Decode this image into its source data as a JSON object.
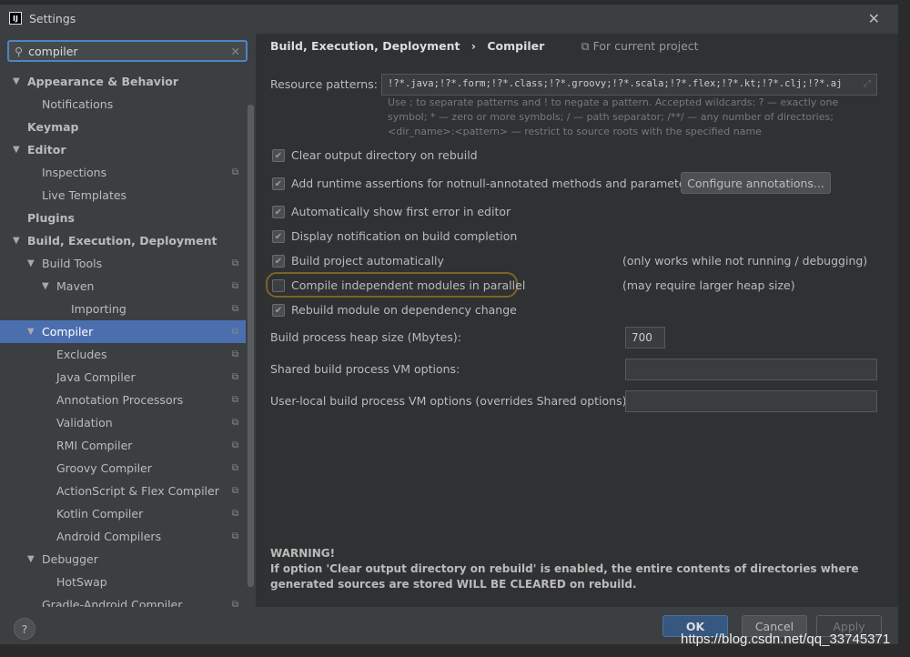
{
  "window": {
    "title": "Settings",
    "logo": "IJ"
  },
  "search": {
    "value": "compiler"
  },
  "tree": [
    {
      "label": "Appearance & Behavior",
      "lvl": 0,
      "bold": true,
      "arrow": true
    },
    {
      "label": "Notifications",
      "lvl": 1
    },
    {
      "label": "Keymap",
      "lvl": 0,
      "bold": true
    },
    {
      "label": "Editor",
      "lvl": 0,
      "bold": true,
      "arrow": true
    },
    {
      "label": "Inspections",
      "lvl": 1,
      "copy": true
    },
    {
      "label": "Live Templates",
      "lvl": 1
    },
    {
      "label": "Plugins",
      "lvl": 0,
      "bold": true
    },
    {
      "label": "Build, Execution, Deployment",
      "lvl": 0,
      "bold": true,
      "arrow": true
    },
    {
      "label": "Build Tools",
      "lvl": 1,
      "arrow": true,
      "copy": true
    },
    {
      "label": "Maven",
      "lvl": 2,
      "arrow": true,
      "copy": true
    },
    {
      "label": "Importing",
      "lvl": 3,
      "copy": true
    },
    {
      "label": "Compiler",
      "lvl": 1,
      "arrow": true,
      "copy": true,
      "selected": true
    },
    {
      "label": "Excludes",
      "lvl": 2,
      "copy": true
    },
    {
      "label": "Java Compiler",
      "lvl": 2,
      "copy": true
    },
    {
      "label": "Annotation Processors",
      "lvl": 2,
      "copy": true
    },
    {
      "label": "Validation",
      "lvl": 2,
      "copy": true
    },
    {
      "label": "RMI Compiler",
      "lvl": 2,
      "copy": true
    },
    {
      "label": "Groovy Compiler",
      "lvl": 2,
      "copy": true
    },
    {
      "label": "ActionScript & Flex Compiler",
      "lvl": 2,
      "copy": true
    },
    {
      "label": "Kotlin Compiler",
      "lvl": 2,
      "copy": true
    },
    {
      "label": "Android Compilers",
      "lvl": 2,
      "copy": true
    },
    {
      "label": "Debugger",
      "lvl": 1,
      "arrow": true
    },
    {
      "label": "HotSwap",
      "lvl": 2
    },
    {
      "label": "Gradle-Android Compiler",
      "lvl": 1,
      "copy": true
    }
  ],
  "header": {
    "section": "Build, Execution, Deployment",
    "sep": "›",
    "page": "Compiler",
    "scope": "For current project"
  },
  "resource": {
    "label": "Resource patterns:",
    "value": "!?*.java;!?*.form;!?*.class;!?*.groovy;!?*.scala;!?*.flex;!?*.kt;!?*.clj;!?*.aj",
    "hint": "Use ; to separate patterns and ! to negate a pattern. Accepted wildcards: ? — exactly one symbol; * — zero or more symbols; / — path separator; /**/ — any number of directories; <dir_name>:<pattern> — restrict to source roots with the specified name"
  },
  "options": [
    {
      "label": "Clear output directory on rebuild",
      "checked": true
    },
    {
      "label": "Add runtime assertions for notnull-annotated methods and parameters",
      "checked": true
    },
    {
      "label": "Automatically show first error in editor",
      "checked": true
    },
    {
      "label": "Display notification on build completion",
      "checked": true
    },
    {
      "label": "Build project automatically",
      "checked": true,
      "note": "(only works while not running / debugging)"
    },
    {
      "label": "Compile independent modules in parallel",
      "checked": false,
      "note": "(may require larger heap size)"
    },
    {
      "label": "Rebuild module on dependency change",
      "checked": true
    }
  ],
  "configure_btn": "Configure annotations...",
  "heap": {
    "label": "Build process heap size (Mbytes):",
    "value": "700"
  },
  "shared_vm": {
    "label": "Shared build process VM options:",
    "value": ""
  },
  "user_vm": {
    "label": "User-local build process VM options (overrides Shared options):",
    "value": ""
  },
  "warning": {
    "title": "WARNING!",
    "text": "If option 'Clear output directory on rebuild' is enabled, the entire contents of directories where generated sources are stored WILL BE CLEARED on rebuild."
  },
  "footer": {
    "help": "?",
    "ok": "OK",
    "cancel": "Cancel",
    "apply": "Apply"
  },
  "watermark": "https://blog.csdn.net/qq_33745371",
  "colors": {
    "accent": "#4b6eaf",
    "ok": "#365880",
    "highlight": "#7a6428"
  }
}
